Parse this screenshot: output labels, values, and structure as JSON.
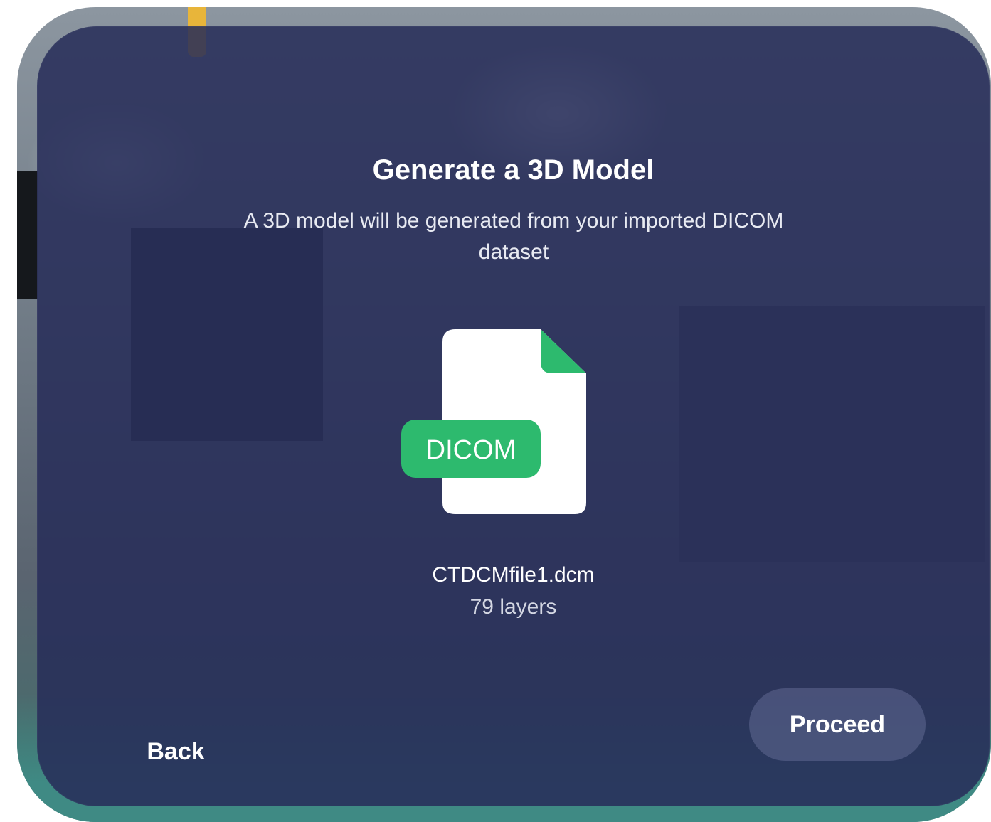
{
  "dialog": {
    "title": "Generate a 3D Model",
    "subtitle": "A 3D model will be generated from your imported DICOM dataset"
  },
  "file": {
    "icon": "dicom-file-icon",
    "badge_label": "DICOM",
    "name": "CTDCMfile1.dcm",
    "layers": "79 layers"
  },
  "actions": {
    "back_label": "Back",
    "proceed_label": "Proceed"
  },
  "colors": {
    "panel": "#262c58",
    "accent_green": "#2dba6e",
    "file_page": "#ffffff"
  }
}
